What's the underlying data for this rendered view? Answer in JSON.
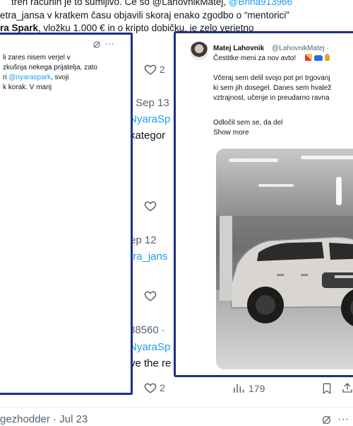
{
  "top_text": {
    "line1_prefix": "treh računih je to sumljivo. Če so @LahovnikMatej,",
    "line1_link": "@Brina913966",
    "line2_prefix": "etra_jansa v kratkem času objavili skoraj enako zgodbo o “mentorici”",
    "line3_bold": "ra Spark",
    "line3_text": ", vložku 1.000 € in o kripto dobičku, je zelo verjetno"
  },
  "left_card": {
    "lines": [
      "li zares nisem verjel v",
      "zkušnja nekega prijatelja, zato",
      "ri",
      ", svoji",
      "k korak. V manj"
    ],
    "mention": "@nyaraspark"
  },
  "background": {
    "like_count_1": "2",
    "date_sep13": "· Sep 13",
    "handle_nyarasp_1": "NyaraSp",
    "text_kategor": "kategor",
    "date_sep12": "ep 12",
    "handle_tra_jansa": "tra_jans",
    "number_38560": "38560 ·",
    "handle_nyarasp_2": "NyaraSp",
    "text_we_the_re": "ve the re",
    "like_count_2": "2",
    "views_count": "179",
    "bottom_user": "gezhodder · Jul 23"
  },
  "right_card": {
    "display_name": "Matej Lahovnik",
    "handle": "@LahovnikMatej ·",
    "line1": "Čestitke meni za nov avto!",
    "para1_line1": "Včeraj sem delil svojo pot pri trgovanj",
    "para1_line2": "ki sem jih dosegel. Danes sem hvalež",
    "para1_line3": "vztrajnost, učenje in preudarno ravna",
    "para2_line1": "Odločil sem se, da del",
    "show_more": "Show more"
  },
  "colors": {
    "accent": "#1d9bf0",
    "frame": "#1f2f87",
    "muted": "#536471"
  }
}
